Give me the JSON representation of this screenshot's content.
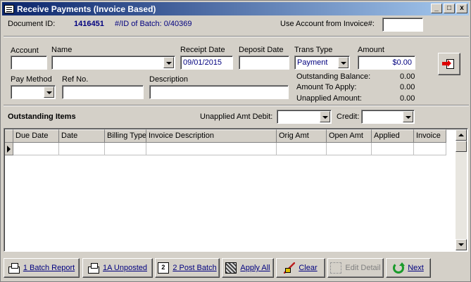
{
  "window": {
    "title": "Receive Payments (Invoice Based)",
    "controls": {
      "minimize": "_",
      "maximize": "□",
      "close": "x"
    }
  },
  "header": {
    "document_id_label": "Document ID:",
    "document_id_value": "1416451",
    "batch_label": "#/ID of Batch: 0/40369",
    "use_account_label": "Use Account from Invoice#:",
    "use_account_value": ""
  },
  "form": {
    "account_label": "Account",
    "account_value": "",
    "name_label": "Name",
    "name_value": "",
    "receipt_date_label": "Receipt Date",
    "receipt_date_value": "09/01/2015",
    "deposit_date_label": "Deposit Date",
    "deposit_date_value": "",
    "trans_type_label": "Trans Type",
    "trans_type_value": "Payment",
    "amount_label": "Amount",
    "amount_value": "$0.00",
    "pay_method_label": "Pay Method",
    "pay_method_value": "",
    "ref_no_label": "Ref No.",
    "ref_no_value": "",
    "description_label": "Description",
    "description_value": "",
    "outstanding_balance_label": "Outstanding Balance:",
    "outstanding_balance_value": "0.00",
    "amount_to_apply_label": "Amount To Apply:",
    "amount_to_apply_value": "0.00",
    "unapplied_amount_label": "Unapplied Amount:",
    "unapplied_amount_value": "0.00"
  },
  "outstanding": {
    "title": "Outstanding Items",
    "unapplied_debit_label": "Unapplied Amt Debit:",
    "unapplied_debit_value": "",
    "credit_label": "Credit:",
    "credit_value": ""
  },
  "grid": {
    "columns": [
      "Due Date",
      "Date",
      "Billing Type",
      "Invoice Description",
      "Orig Amt",
      "Open Amt",
      "Applied",
      "Invoice"
    ]
  },
  "toolbar": {
    "batch_report": "1 Batch Report",
    "unposted": "1A Unposted",
    "post_batch": "2 Post Batch",
    "apply_all": "Apply All",
    "clear": "Clear",
    "edit_detail": "Edit Detail",
    "next": "Next"
  },
  "colors": {
    "label_blue": "#00007f",
    "title_gradient_start": "#0a246a",
    "next_green": "#1a9b2b"
  }
}
